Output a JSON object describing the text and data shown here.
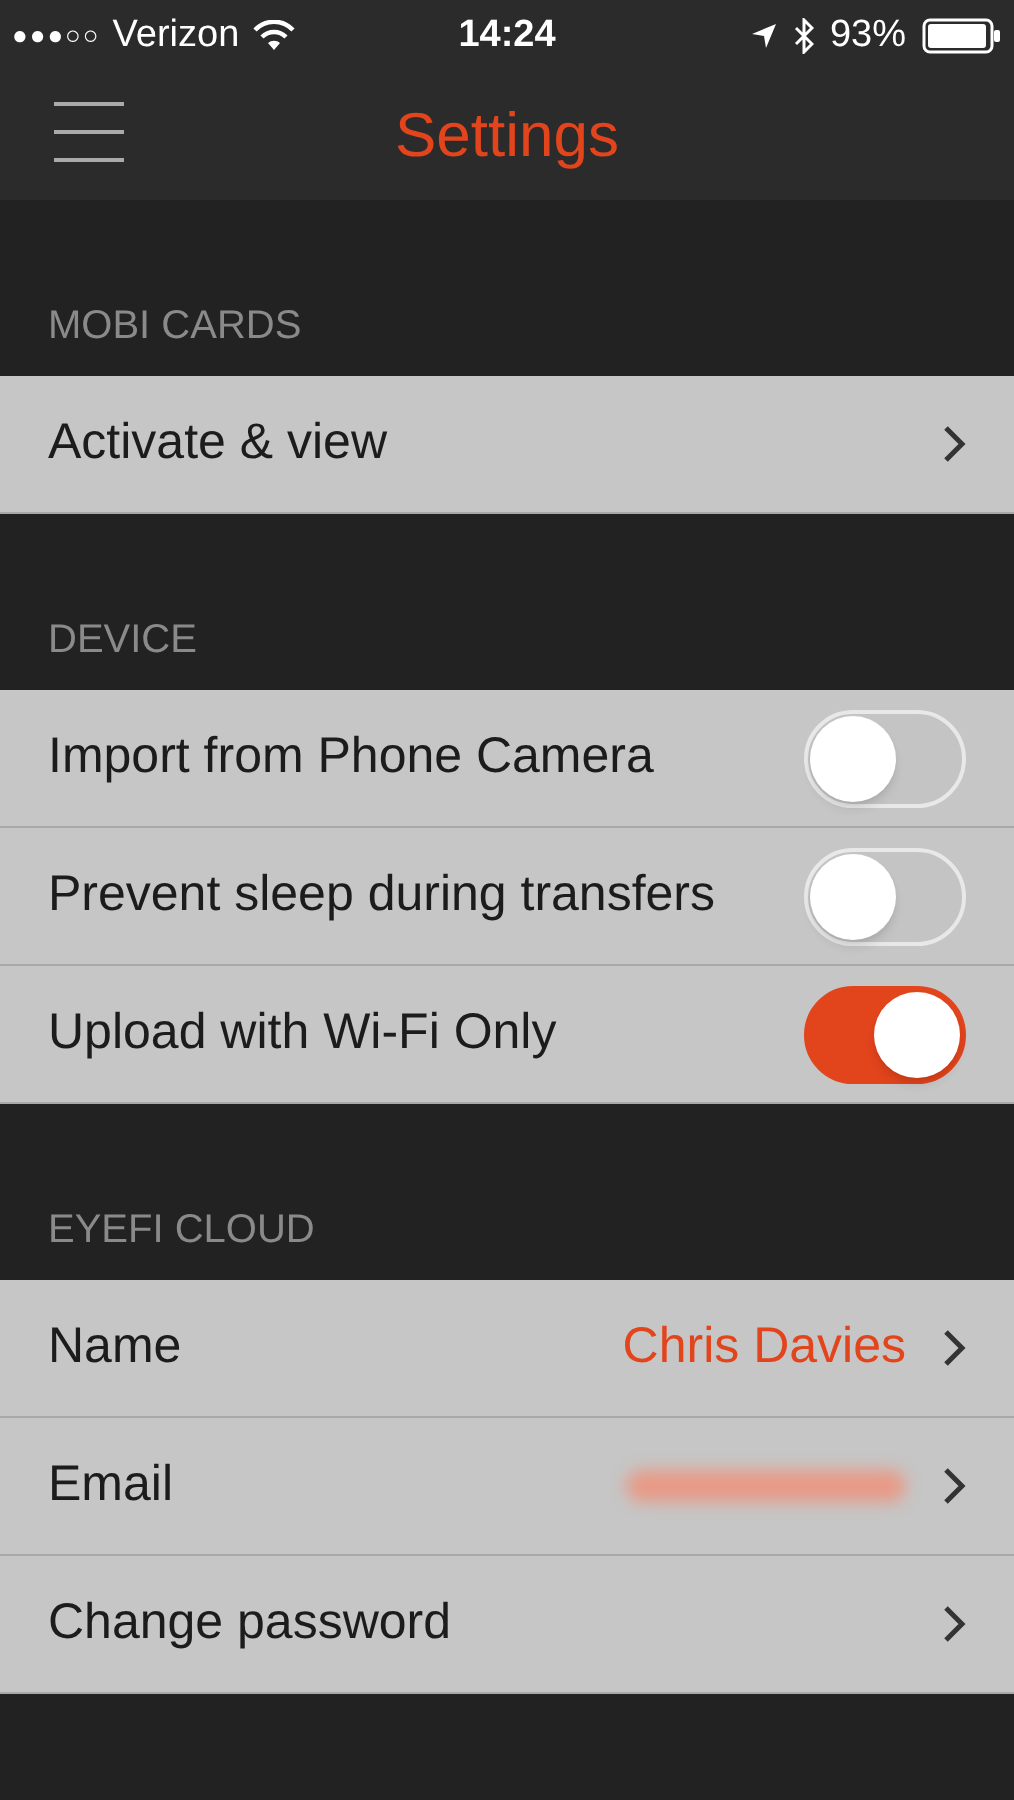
{
  "status_bar": {
    "signal": "●●●○○",
    "carrier": "Verizon",
    "time": "14:24",
    "battery": "93%"
  },
  "nav": {
    "title": "Settings"
  },
  "sections": [
    {
      "header": "MOBI CARDS",
      "rows": [
        {
          "kind": "link",
          "label": "Activate & view"
        }
      ]
    },
    {
      "header": "DEVICE",
      "rows": [
        {
          "kind": "toggle",
          "label": "Import from Phone Camera",
          "on": false
        },
        {
          "kind": "toggle",
          "label": "Prevent sleep during transfers",
          "on": false
        },
        {
          "kind": "toggle",
          "label": "Upload with Wi-Fi Only",
          "on": true
        }
      ]
    },
    {
      "header": "EYEFI CLOUD",
      "rows": [
        {
          "kind": "value",
          "label": "Name",
          "value": "Chris Davies"
        },
        {
          "kind": "hidden_value",
          "label": "Email"
        },
        {
          "kind": "link",
          "label": "Change password"
        }
      ]
    }
  ]
}
